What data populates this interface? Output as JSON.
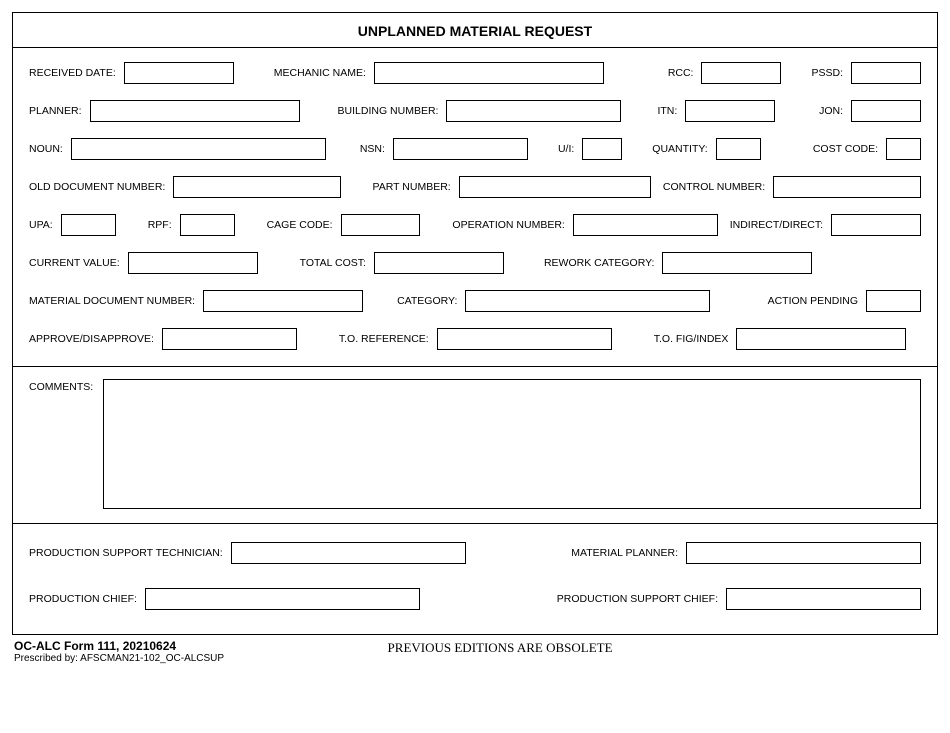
{
  "title": "UNPLANNED MATERIAL REQUEST",
  "labels": {
    "received_date": "RECEIVED DATE:",
    "mechanic_name": "MECHANIC NAME:",
    "rcc": "RCC:",
    "pssd": "PSSD:",
    "planner": "PLANNER:",
    "building_number": "BUILDING NUMBER:",
    "itn": "ITN:",
    "jon": "JON:",
    "noun": "NOUN:",
    "nsn": "NSN:",
    "ui": "U/I:",
    "quantity": "QUANTITY:",
    "cost_code": "COST  CODE:",
    "old_document_number": "OLD DOCUMENT NUMBER:",
    "part_number": "PART NUMBER:",
    "control_number": "CONTROL NUMBER:",
    "upa": "UPA:",
    "rpf": "RPF:",
    "cage_code": "CAGE CODE:",
    "operation_number": "OPERATION NUMBER:",
    "indirect_direct": "INDIRECT/DIRECT:",
    "current_value": "CURRENT VALUE:",
    "total_cost": "TOTAL COST:",
    "rework_category": "REWORK CATEGORY:",
    "material_document_number": "MATERIAL DOCUMENT NUMBER:",
    "category": "CATEGORY:",
    "action_pending": "ACTION PENDING",
    "approve_disapprove": "APPROVE/DISAPPROVE:",
    "to_reference": "T.O. REFERENCE:",
    "to_fig_index": "T.O. FIG/INDEX",
    "comments": "COMMENTS:",
    "production_support_technician": "PRODUCTION SUPPORT TECHNICIAN:",
    "material_planner": "MATERIAL PLANNER:",
    "production_chief": "PRODUCTION CHIEF:",
    "production_support_chief": "PRODUCTION SUPPORT CHIEF:"
  },
  "footer": {
    "form_id": "OC-ALC Form 111, 20210624",
    "prescribed": "Prescribed by: AFSCMAN21-102_OC-ALCSUP",
    "obsolete": "PREVIOUS EDITIONS ARE OBSOLETE"
  }
}
